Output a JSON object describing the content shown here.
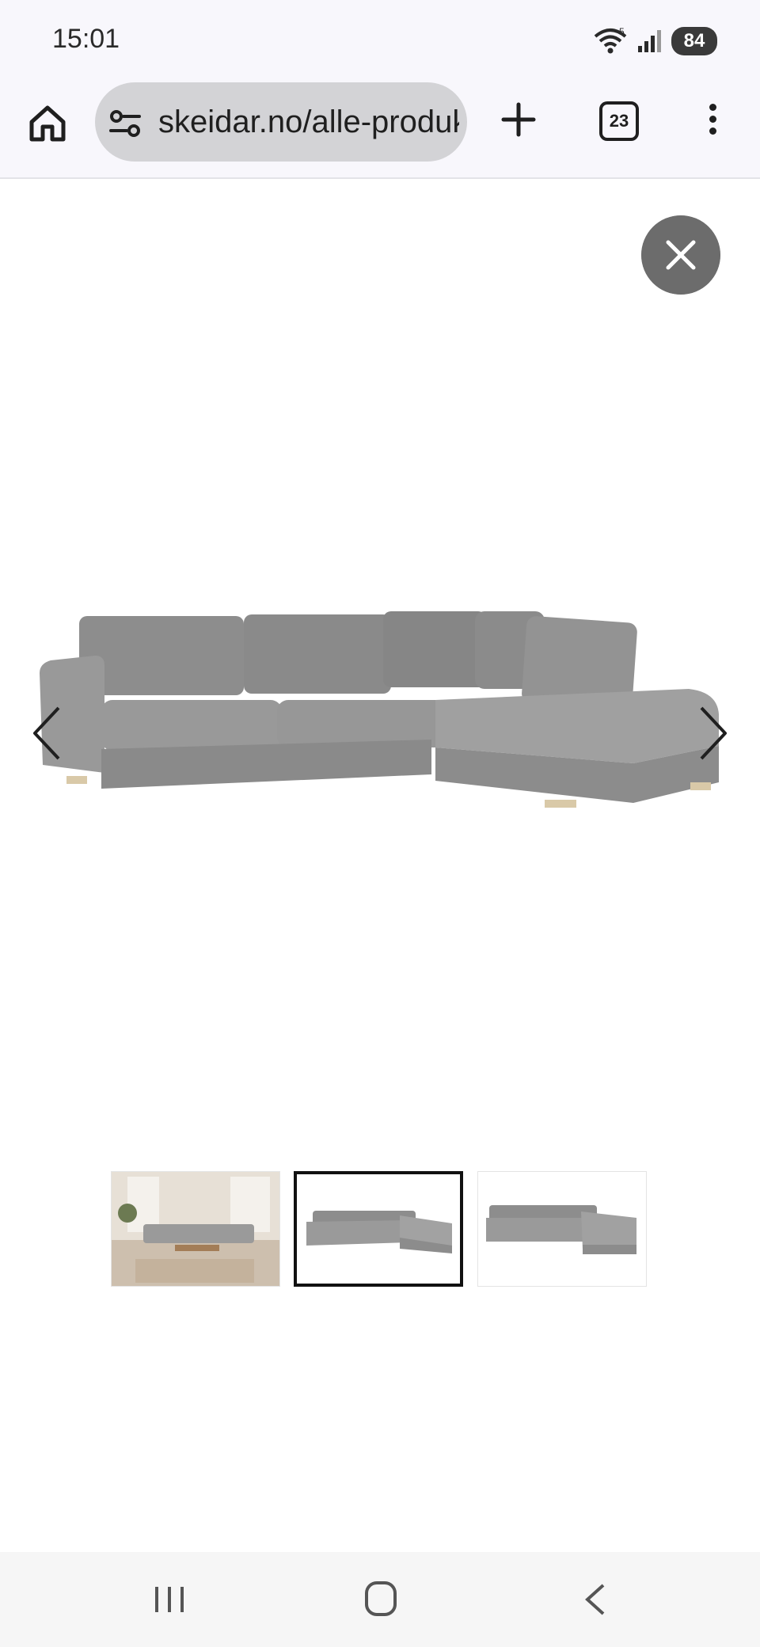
{
  "status_bar": {
    "time": "15:01",
    "battery": "84",
    "icons": [
      "wifi-icon",
      "signal-icon",
      "battery-icon"
    ]
  },
  "browser": {
    "url": "skeidar.no/alle-produkter",
    "tab_count": "23",
    "icons": [
      "home-icon",
      "site-settings-icon",
      "new-tab-icon",
      "tabs-icon",
      "more-menu-icon"
    ]
  },
  "gallery": {
    "selected_index": 1,
    "thumbnails": [
      {
        "name": "thumbnail-living-room"
      },
      {
        "name": "thumbnail-sofa-angle"
      },
      {
        "name": "thumbnail-sofa-front"
      }
    ],
    "icons": [
      "close-icon",
      "chevron-left-icon",
      "chevron-right-icon"
    ]
  },
  "colors": {
    "sofa": "#8f8f8f",
    "close_button": "#6c6c6c",
    "url_pill": "#d3d3d6"
  },
  "system_nav": {
    "icons": [
      "recent-apps-icon",
      "home-button-icon",
      "back-icon"
    ]
  }
}
